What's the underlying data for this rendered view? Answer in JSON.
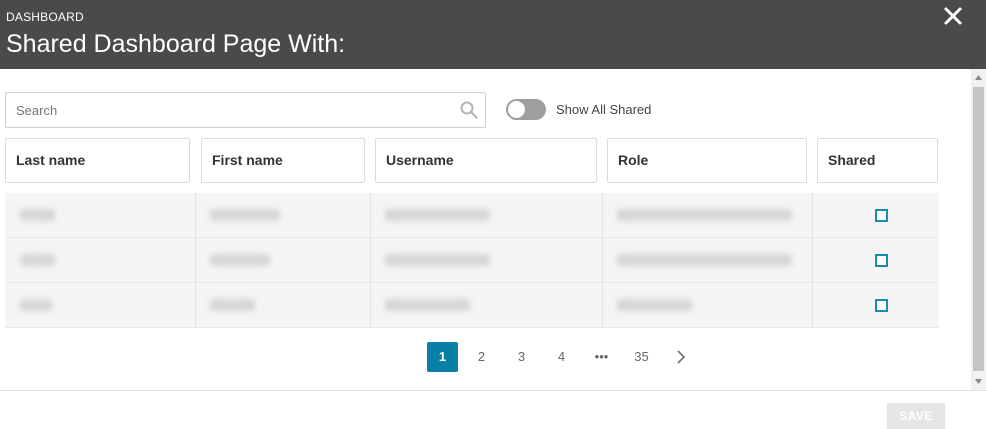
{
  "header": {
    "kicker": "DASHBOARD",
    "title": "Shared Dashboard Page With:"
  },
  "search": {
    "placeholder": "Search",
    "value": ""
  },
  "toggle": {
    "label": "Show All Shared",
    "on": false
  },
  "table": {
    "columns": [
      "Last name",
      "First name",
      "Username",
      "Role",
      "Shared"
    ],
    "rows": [
      {
        "shared": false
      },
      {
        "shared": false
      },
      {
        "shared": false
      }
    ]
  },
  "pagination": {
    "pages": [
      "1",
      "2",
      "3",
      "4",
      "•••",
      "35"
    ],
    "current": "1",
    "next": "›"
  },
  "footer": {
    "save_label": "SAVE"
  },
  "colors": {
    "header_bg": "#4a4a4a",
    "accent": "#0a7fa6",
    "checkbox": "#1a8cb0"
  },
  "icons": {
    "close": "close-icon",
    "search": "search-icon",
    "next": "chevron-right-icon"
  }
}
